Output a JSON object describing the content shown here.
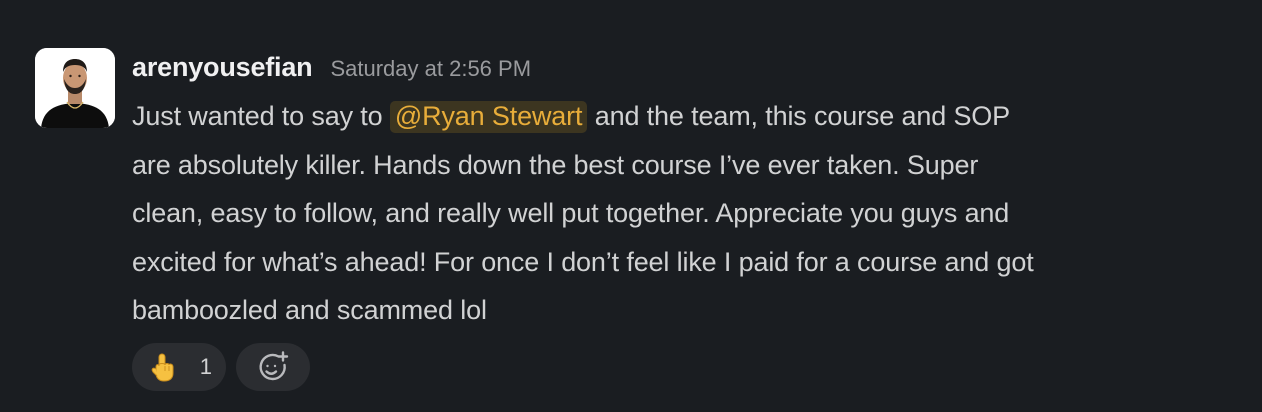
{
  "message": {
    "username": "arenyousefian",
    "timestamp": "Saturday at 2:56 PM",
    "lines": [
      {
        "before": "Just wanted to say to ",
        "mention": "@Ryan Stewart",
        "after": " and the team, this course and SOP"
      },
      {
        "text": "are absolutely killer. Hands down the best course I’ve ever taken. Super"
      },
      {
        "text": "clean, easy to follow, and really well put together. Appreciate you guys and"
      },
      {
        "text": "excited for what’s ahead! For once I don’t feel like I paid for a course and got"
      },
      {
        "text": "bamboozled and scammed lol"
      }
    ]
  },
  "reactions": [
    {
      "emoji": "pointing-up-hand-icon",
      "count": "1"
    }
  ],
  "add_reaction": {
    "icon": "add-emoji-icon"
  },
  "colors": {
    "background": "#1a1d21",
    "mention_text": "#e8ad3a",
    "mention_bg": "#3c3520",
    "reaction_bg": "#2b2d31"
  }
}
